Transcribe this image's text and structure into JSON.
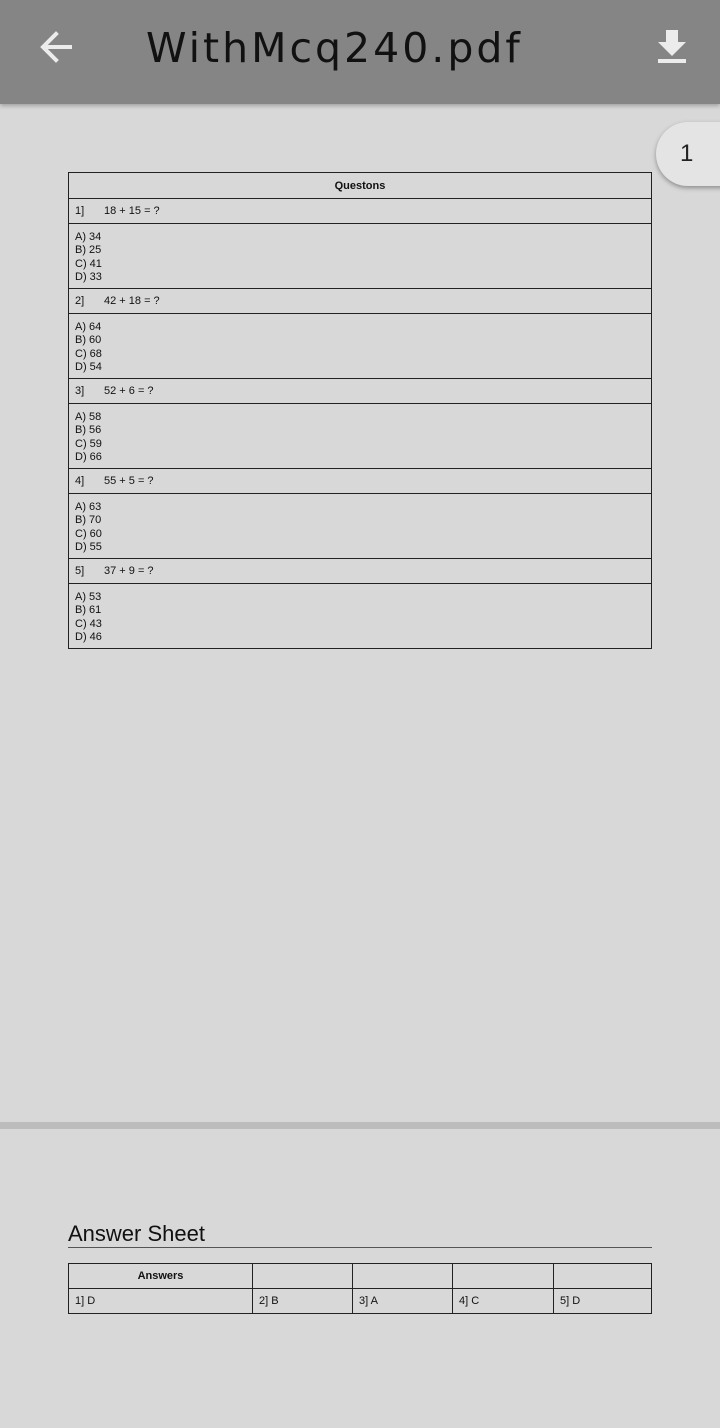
{
  "header": {
    "title": "WithMcq240.pdf",
    "back_icon": "arrow-left-icon",
    "download_icon": "download-icon"
  },
  "page_indicator": "1",
  "questions_table": {
    "header": "Questons",
    "questions": [
      {
        "num": "1]",
        "text": "18  +  15 =  ?",
        "options": [
          "A) 34",
          "B) 25",
          "C) 41",
          "D) 33"
        ]
      },
      {
        "num": "2]",
        "text": "42  +  18 =  ?",
        "options": [
          "A) 64",
          "B) 60",
          "C) 68",
          "D) 54"
        ]
      },
      {
        "num": "3]",
        "text": "52  +  6 =  ?",
        "options": [
          "A) 58",
          "B) 56",
          "C) 59",
          "D) 66"
        ]
      },
      {
        "num": "4]",
        "text": "55  +  5 =  ?",
        "options": [
          "A) 63",
          "B) 70",
          "C) 60",
          "D) 55"
        ]
      },
      {
        "num": "5]",
        "text": "37  +  9 =  ?",
        "options": [
          "A) 53",
          "B) 61",
          "C) 43",
          "D) 46"
        ]
      }
    ]
  },
  "answer_sheet": {
    "title": "Answer Sheet",
    "header": "Answers",
    "answers": [
      "1] D",
      "2] B",
      "3] A",
      "4] C",
      "5] D"
    ]
  },
  "colors": {
    "toolbar": "#858585",
    "background": "#d8d8d8",
    "icon": "#e8e8e8"
  }
}
